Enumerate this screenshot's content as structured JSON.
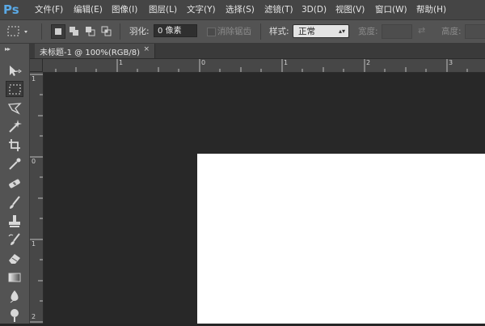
{
  "app": {
    "logo": "Ps"
  },
  "menu": [
    {
      "label": "文件(F)"
    },
    {
      "label": "编辑(E)"
    },
    {
      "label": "图像(I)"
    },
    {
      "label": "图层(L)"
    },
    {
      "label": "文字(Y)"
    },
    {
      "label": "选择(S)"
    },
    {
      "label": "滤镜(T)"
    },
    {
      "label": "3D(D)"
    },
    {
      "label": "视图(V)"
    },
    {
      "label": "窗口(W)"
    },
    {
      "label": "帮助(H)"
    }
  ],
  "options": {
    "feather_label": "羽化:",
    "feather_value": "0 像素",
    "antialias_label": "消除锯齿",
    "style_label": "样式:",
    "style_value": "正常",
    "width_label": "宽度:",
    "height_label": "高度:"
  },
  "document_tab": {
    "title": "未标题-1 @ 100%(RGB/8)",
    "close": "×"
  },
  "ruler": {
    "horizontal": [
      "1",
      "0",
      "1",
      "2",
      "3"
    ],
    "vertical": [
      "1",
      "0",
      "1",
      "2"
    ]
  },
  "colors": {
    "accent": "#5aa9e6",
    "canvas_bg": "#282828",
    "document": "#ffffff"
  },
  "tools": [
    "move-tool-icon",
    "marquee-tool-icon",
    "lasso-tool-icon",
    "magic-wand-icon",
    "crop-tool-icon",
    "eyedropper-icon",
    "healing-brush-icon",
    "brush-tool-icon",
    "clone-stamp-icon",
    "history-brush-icon",
    "eraser-icon",
    "gradient-tool-icon",
    "blur-tool-icon",
    "dodge-tool-icon"
  ]
}
